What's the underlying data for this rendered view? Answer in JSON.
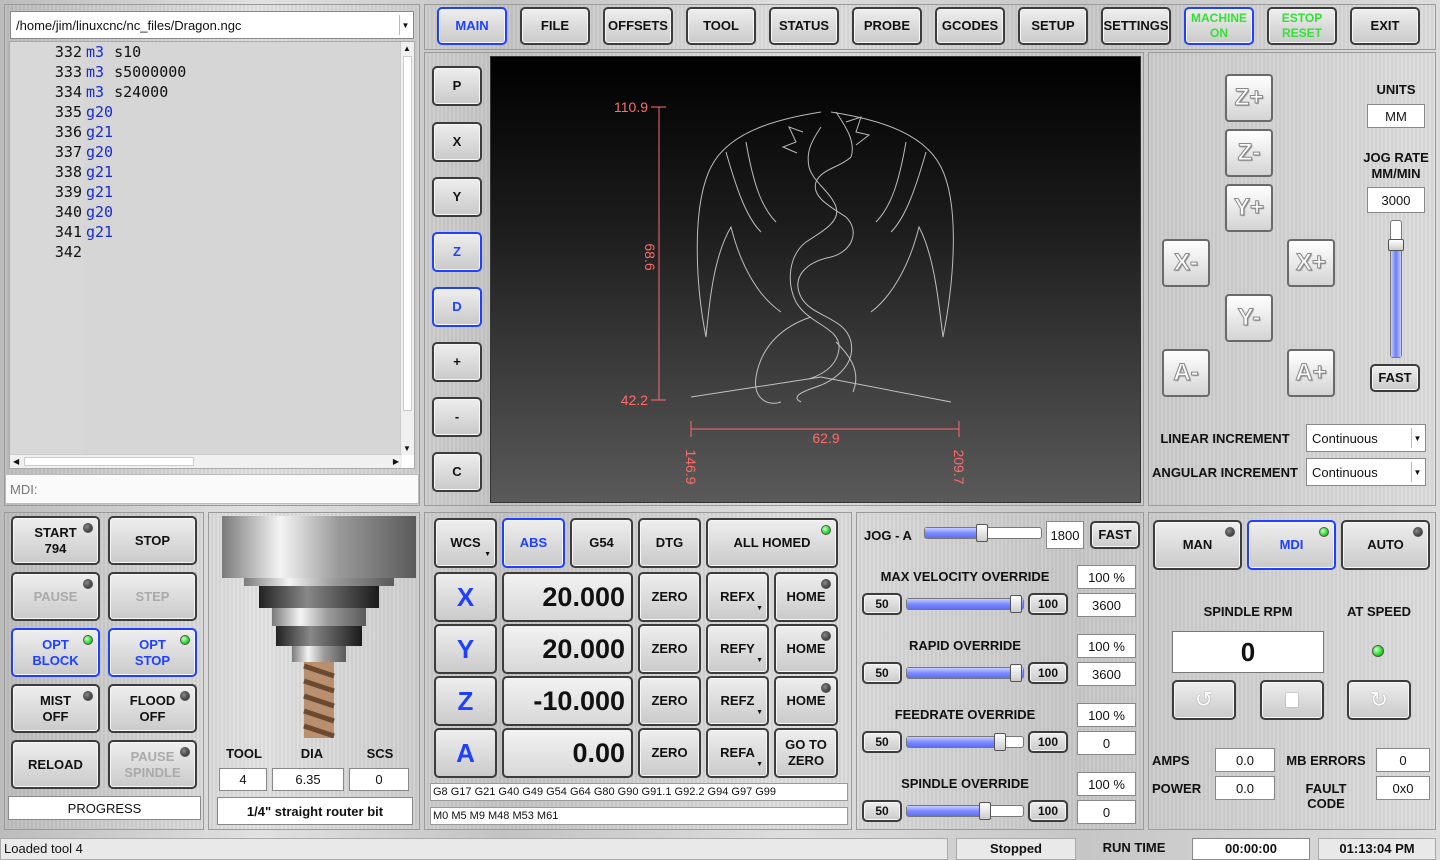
{
  "file_path": "/home/jim/linuxcnc/nc_files/Dragon.ngc",
  "gcode_lines": [
    {
      "num": "332",
      "word": "m3",
      "param": "s10"
    },
    {
      "num": "333",
      "word": "m3",
      "param": "s5000000"
    },
    {
      "num": "334",
      "word": "m3",
      "param": "s24000"
    },
    {
      "num": "335",
      "word": "g20",
      "param": ""
    },
    {
      "num": "336",
      "word": "g21",
      "param": ""
    },
    {
      "num": "337",
      "word": "g20",
      "param": ""
    },
    {
      "num": "338",
      "word": "g21",
      "param": ""
    },
    {
      "num": "339",
      "word": "g21",
      "param": ""
    },
    {
      "num": "340",
      "word": "g20",
      "param": ""
    },
    {
      "num": "341",
      "word": "g21",
      "param": ""
    },
    {
      "num": "342",
      "word": "",
      "param": ""
    }
  ],
  "mdi_placeholder": "MDI:",
  "top_tabs": [
    "MAIN",
    "FILE",
    "OFFSETS",
    "TOOL",
    "STATUS",
    "PROBE",
    "GCODES",
    "SETUP",
    "SETTINGS"
  ],
  "machine_on": "MACHINE ON",
  "estop_reset": "ESTOP RESET",
  "exit_label": "EXIT",
  "view_buttons": [
    "P",
    "X",
    "Y",
    "Z",
    "D",
    "+",
    "-",
    "C"
  ],
  "preview": {
    "dim_top": "110.9",
    "dim_mid": "68.6",
    "dim_bottom": "42.2",
    "dim_width": "62.9",
    "dim_left": "146.9",
    "dim_right": "209.7"
  },
  "jog": {
    "units_label": "UNITS",
    "units_value": "MM",
    "rate_label_1": "JOG RATE",
    "rate_label_2": "MM/MIN",
    "rate_value": "3000",
    "fast_label": "FAST",
    "buttons": {
      "zp": "Z+",
      "zm": "Z-",
      "yp": "Y+",
      "ym": "Y-",
      "xm": "X-",
      "xp": "X+",
      "am": "A-",
      "ap": "A+"
    },
    "linear_label": "LINEAR INCREMENT",
    "linear_value": "Continuous",
    "angular_label": "ANGULAR INCREMENT",
    "angular_value": "Continuous"
  },
  "program_buttons": {
    "start": "START",
    "start_line": "794",
    "stop": "STOP",
    "pause": "PAUSE",
    "step": "STEP",
    "opt_block_1": "OPT",
    "opt_block_2": "BLOCK",
    "opt_stop_1": "OPT",
    "opt_stop_2": "STOP",
    "mist_1": "MIST",
    "mist_2": "OFF",
    "flood_1": "FLOOD",
    "flood_2": "OFF",
    "reload": "RELOAD",
    "pause_spindle_1": "PAUSE",
    "pause_spindle_2": "SPINDLE",
    "progress": "PROGRESS"
  },
  "tool": {
    "tool_label": "TOOL",
    "dia_label": "DIA",
    "scs_label": "SCS",
    "tool": "4",
    "dia": "6.35",
    "scs": "0",
    "description": "1/4\" straight router bit"
  },
  "dro": {
    "wcs": "WCS",
    "abs": "ABS",
    "g54": "G54",
    "dtg": "DTG",
    "all_homed": "ALL HOMED",
    "axes": [
      {
        "name": "X",
        "value": "20.000",
        "zero": "ZERO",
        "ref": "REFX",
        "home": "HOME"
      },
      {
        "name": "Y",
        "value": "20.000",
        "zero": "ZERO",
        "ref": "REFY",
        "home": "HOME"
      },
      {
        "name": "Z",
        "value": "-10.000",
        "zero": "ZERO",
        "ref": "REFZ",
        "home": "HOME"
      },
      {
        "name": "A",
        "value": "0.00",
        "zero": "ZERO",
        "ref": "REFA",
        "home": "GO TO ZERO"
      }
    ],
    "gcodes": "G8 G17 G21 G40 G49 G54 G64 G80 G90 G91.1 G92.2 G94 G97 G99",
    "mcodes": "M0 M5 M9 M48 M53 M61"
  },
  "overrides": {
    "jog_a_label": "JOG - A",
    "jog_a_value": "1800",
    "jog_a_fast": "FAST",
    "jog_a_level": 0.49,
    "items": [
      {
        "label": "MAX VELOCITY OVERRIDE",
        "percent": "100 %",
        "value": "3600",
        "low": "50",
        "high": "100",
        "level": 1.0
      },
      {
        "label": "RAPID OVERRIDE",
        "percent": "100 %",
        "value": "3600",
        "low": "50",
        "high": "100",
        "level": 1.0
      },
      {
        "label": "FEEDRATE OVERRIDE",
        "percent": "100 %",
        "value": "0",
        "low": "50",
        "high": "100",
        "level": 0.8
      },
      {
        "label": "SPINDLE OVERRIDE",
        "percent": "100 %",
        "value": "0",
        "low": "50",
        "high": "100",
        "level": 0.67
      }
    ]
  },
  "modes": {
    "man": "MAN",
    "mdi": "MDI",
    "auto": "AUTO"
  },
  "spindle": {
    "rpm_label": "SPINDLE RPM",
    "at_speed_label": "AT SPEED",
    "rpm": "0",
    "amps_label": "AMPS",
    "amps": "0.0",
    "power_label": "POWER",
    "power": "0.0",
    "mb_errors_label": "MB ERRORS",
    "mb_errors": "0",
    "fault_label": "FAULT CODE",
    "fault": "0x0"
  },
  "status_bar": {
    "message": "Loaded tool 4",
    "state": "Stopped",
    "run_time_label": "RUN TIME",
    "run_time": "00:00:00",
    "clock": "01:13:04 PM"
  },
  "colors": {
    "accent": "#1f40ff",
    "led_on": "#2ee02e",
    "machine_text": "#35e035",
    "preview_dim": "#ff6b6b"
  }
}
